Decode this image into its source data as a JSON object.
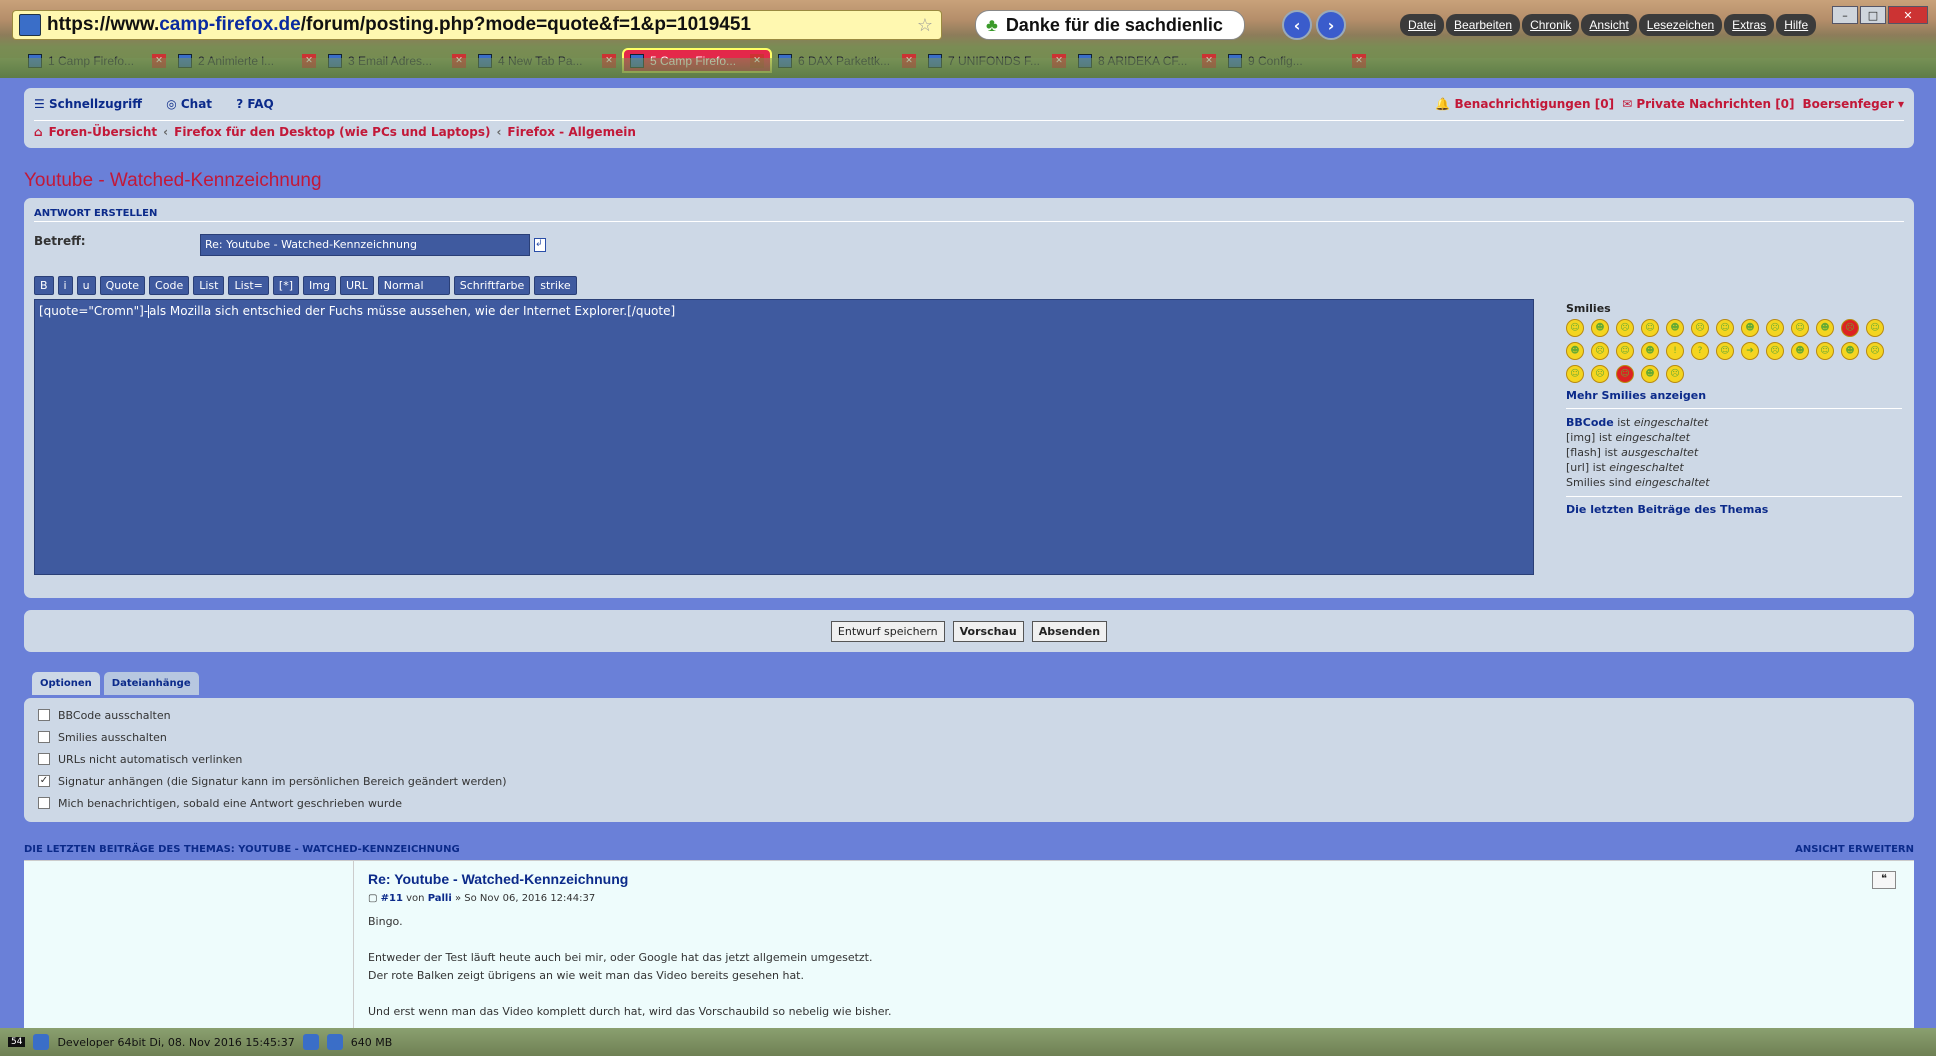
{
  "browser": {
    "url_prefix": "https://www.",
    "url_domain": "camp-firefox.de",
    "url_rest": "/forum/posting.php?mode=quote&f=1&p=1019451",
    "title_box": "Danke für die sachdienlic",
    "menu": [
      "Datei",
      "Bearbeiten",
      "Chronik",
      "Ansicht",
      "Lesezeichen",
      "Extras",
      "Hilfe"
    ],
    "tabs": [
      {
        "label": "1 Camp Firefo..."
      },
      {
        "label": "2 Animierte l..."
      },
      {
        "label": "3 Email Adres..."
      },
      {
        "label": "4 New Tab Pa..."
      },
      {
        "label": "5 Camp Firefo..."
      },
      {
        "label": "6 DAX Parkettk..."
      },
      {
        "label": "7 UNIFONDS F..."
      },
      {
        "label": "8 ARIDEKA CF..."
      },
      {
        "label": "9 Config..."
      }
    ]
  },
  "nav": {
    "quick": "Schnellzugriff",
    "chat": "Chat",
    "faq": "FAQ",
    "notifications": "Benachrichtigungen [0]",
    "messages": "Private Nachrichten [0]",
    "user": "Boersenfeger",
    "crumbs": [
      "Foren-Übersicht",
      "Firefox für den Desktop (wie PCs und Laptops)",
      "Firefox - Allgemein"
    ]
  },
  "page_title": "Youtube - Watched-Kennzeichnung",
  "compose": {
    "header": "ANTWORT ERSTELLEN",
    "subject_label": "Betreff:",
    "subject_value": "Re: Youtube - Watched-Kennzeichnung",
    "bbcode": [
      "B",
      "i",
      "u",
      "Quote",
      "Code",
      "List",
      "List=",
      "[*]",
      "Img",
      "URL",
      "Normal",
      "Schriftfarbe",
      "strike"
    ],
    "text_before": "[quote=\"Cromn\"]-",
    "text_after": "als Mozilla sich entschied der Fuchs müsse aussehen, wie der Internet Explorer.[/quote]"
  },
  "sidebar": {
    "smilies_label": "Smilies",
    "more_smilies": "Mehr Smilies anzeigen",
    "status": [
      {
        "name": "BBCode",
        "verb": "ist",
        "state": "eingeschaltet"
      },
      {
        "name": "[img]",
        "verb": "ist",
        "state": "eingeschaltet"
      },
      {
        "name": "[flash]",
        "verb": "ist",
        "state": "ausgeschaltet"
      },
      {
        "name": "[url]",
        "verb": "ist",
        "state": "eingeschaltet"
      },
      {
        "name": "Smilies",
        "verb": "sind",
        "state": "eingeschaltet"
      }
    ],
    "last_posts": "Die letzten Beiträge des Themas"
  },
  "actions": {
    "draft": "Entwurf speichern",
    "preview": "Vorschau",
    "submit": "Absenden"
  },
  "options": {
    "tabs": [
      "Optionen",
      "Dateianhänge"
    ],
    "items": [
      {
        "label": "BBCode ausschalten",
        "checked": false
      },
      {
        "label": "Smilies ausschalten",
        "checked": false
      },
      {
        "label": "URLs nicht automatisch verlinken",
        "checked": false
      },
      {
        "label": "Signatur anhängen (die Signatur kann im persönlichen Bereich geändert werden)",
        "checked": true
      },
      {
        "label": "Mich benachrichtigen, sobald eine Antwort geschrieben wurde",
        "checked": false
      }
    ]
  },
  "latest": {
    "title": "DIE LETZTEN BEITRÄGE DES THEMAS: YOUTUBE - WATCHED-KENNZEICHNUNG",
    "expand": "ANSICHT ERWEITERN",
    "post_title": "Re: Youtube - Watched-Kennzeichnung",
    "post_num": "#11",
    "post_by": "von",
    "post_author": "Palli",
    "post_date": "» So Nov 06, 2016 12:44:37",
    "lines": [
      "Bingo.",
      "",
      "Entweder der Test läuft heute auch bei mir, oder Google hat das jetzt allgemein umgesetzt.",
      "Der rote Balken zeigt übrigens an wie weit man das Video bereits gesehen hat.",
      "",
      "Und erst wenn man das Video komplett durch hat, wird das Vorschaubild so nebelig wie bisher."
    ]
  },
  "taskbar": {
    "badge": "54",
    "info": "Developer 64bit  Di, 08. Nov 2016    15:45:37",
    "mem": "640 MB"
  }
}
